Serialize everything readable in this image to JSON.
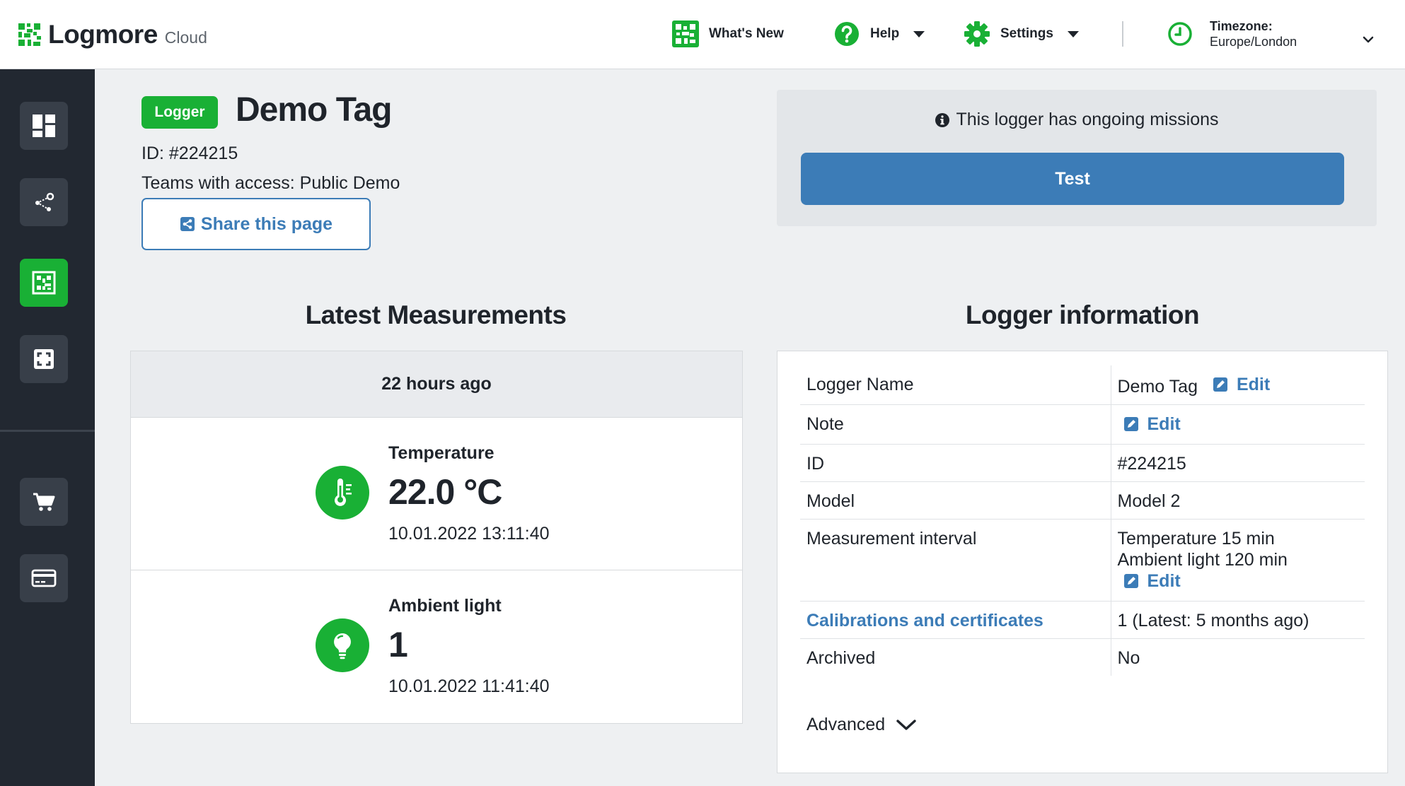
{
  "brand": {
    "name": "Logmore",
    "sub": "Cloud"
  },
  "nav": {
    "whats_new": "What's New",
    "help": "Help",
    "settings": "Settings",
    "timezone_label": "Timezone:",
    "timezone_value": "Europe/London"
  },
  "colors": {
    "accent_green": "#19b035",
    "link_blue": "#3c7cb7",
    "sidebar_bg": "#222831"
  },
  "sidebar": {
    "items": [
      {
        "name": "dashboard",
        "icon": "dashboard-icon"
      },
      {
        "name": "share-network",
        "icon": "share-network-icon"
      },
      {
        "name": "logger",
        "icon": "qr-logger-icon",
        "active": true
      },
      {
        "name": "scan",
        "icon": "scan-frame-icon"
      },
      {
        "name": "shop",
        "icon": "cart-icon"
      },
      {
        "name": "billing",
        "icon": "credit-card-icon"
      }
    ]
  },
  "page": {
    "badge": "Logger",
    "title": "Demo Tag",
    "id_text": "ID: #224215",
    "teams_text": "Teams with access: Public Demo",
    "share_label": "Share this page"
  },
  "missions": {
    "message": "This logger has ongoing missions",
    "button": "Test"
  },
  "latest": {
    "title": "Latest Measurements",
    "updated": "22 hours ago",
    "items": [
      {
        "label": "Temperature",
        "value": "22.0 °C",
        "time": "10.01.2022 13:11:40",
        "icon": "thermometer-icon"
      },
      {
        "label": "Ambient light",
        "value": "1",
        "time": "10.01.2022 11:41:40",
        "icon": "lightbulb-icon"
      }
    ]
  },
  "info": {
    "title": "Logger information",
    "edit_label": "Edit",
    "rows": {
      "name_k": "Logger Name",
      "name_v": "Demo Tag",
      "note_k": "Note",
      "id_k": "ID",
      "id_v": "#224215",
      "model_k": "Model",
      "model_v": "Model 2",
      "interval_k": "Measurement interval",
      "interval_v1": "Temperature 15 min",
      "interval_v2": "Ambient light 120 min",
      "calib_k": "Calibrations and certificates",
      "calib_v": "1 (Latest: 5 months ago)",
      "archived_k": "Archived",
      "archived_v": "No"
    },
    "advanced": "Advanced"
  }
}
